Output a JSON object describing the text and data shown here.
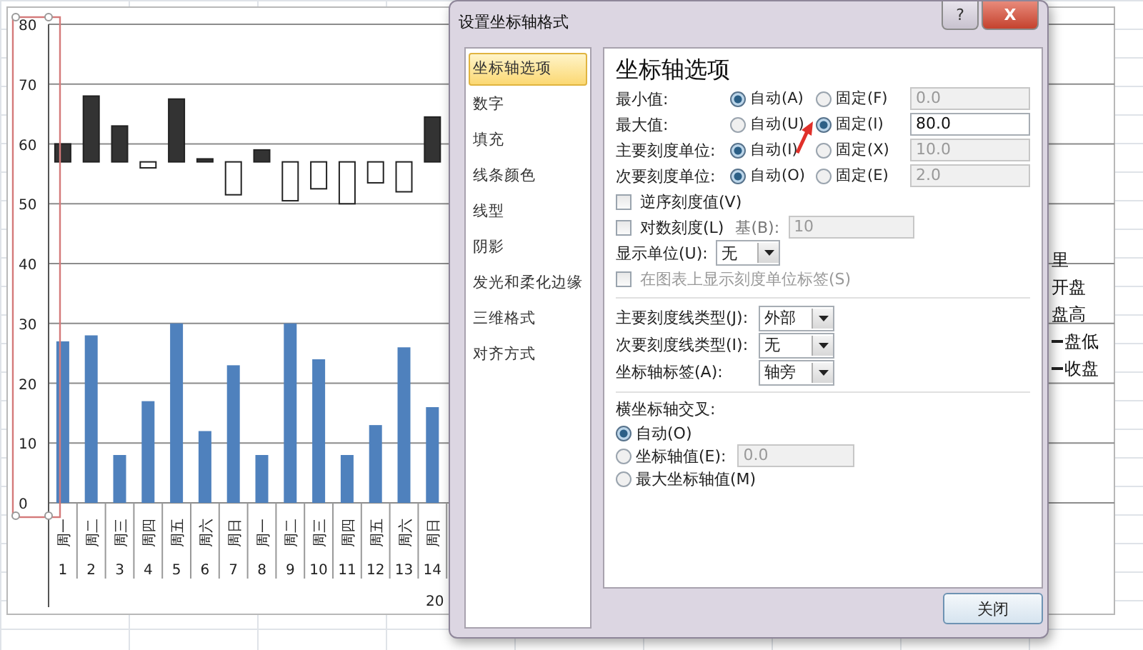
{
  "chart": {
    "chart_data": {
      "type": "bar",
      "categories": [
        "周一",
        "周二",
        "周三",
        "周四",
        "周五",
        "周六",
        "周日",
        "周一",
        "周二",
        "周三",
        "周四",
        "周五",
        "周六",
        "周日"
      ],
      "xlabel": "20",
      "ylim": [
        0,
        80
      ],
      "yticks": [
        0,
        10,
        20,
        30,
        40,
        50,
        60,
        70,
        80
      ],
      "grid": true,
      "series": [
        {
          "color": "#4f81bd",
          "values": [
            27,
            28,
            8,
            17,
            30,
            12,
            23,
            8,
            30,
            24,
            8,
            13,
            26,
            16
          ]
        }
      ]
    },
    "category_numbers": [
      "1",
      "2",
      "3",
      "4",
      "5",
      "6",
      "7",
      "8",
      "9",
      "10",
      "11",
      "12",
      "13",
      "14"
    ],
    "legend": [
      {
        "label": "里",
        "line": false
      },
      {
        "label": "开盘",
        "line": false
      },
      {
        "label": "盘高",
        "line": false
      },
      {
        "label": "盘低",
        "line": true
      },
      {
        "label": "收盘",
        "line": true
      }
    ]
  },
  "dialog": {
    "title": "设置坐标轴格式",
    "help": "?",
    "close": "X",
    "nav": [
      {
        "label": "坐标轴选项",
        "selected": true
      },
      {
        "label": "数字",
        "selected": false
      },
      {
        "label": "填充",
        "selected": false
      },
      {
        "label": "线条颜色",
        "selected": false
      },
      {
        "label": "线型",
        "selected": false
      },
      {
        "label": "阴影",
        "selected": false
      },
      {
        "label": "发光和柔化边缘",
        "selected": false
      },
      {
        "label": "三维格式",
        "selected": false
      },
      {
        "label": "对齐方式",
        "selected": false
      }
    ],
    "heading": "坐标轴选项",
    "axis_rows": [
      {
        "label": "最小值:",
        "options": [
          {
            "label": "自动(A)",
            "selected": true
          },
          {
            "label": "固定(F)",
            "selected": false
          }
        ],
        "value": "0.0",
        "disabled": true
      },
      {
        "label": "最大值:",
        "options": [
          {
            "label": "自动(U)",
            "selected": false
          },
          {
            "label": "固定(I)",
            "selected": true
          }
        ],
        "value": "80.0",
        "disabled": false
      },
      {
        "label": "主要刻度单位:",
        "options": [
          {
            "label": "自动(I)",
            "selected": true
          },
          {
            "label": "固定(X)",
            "selected": false
          }
        ],
        "value": "10.0",
        "disabled": true
      },
      {
        "label": "次要刻度单位:",
        "options": [
          {
            "label": "自动(O)",
            "selected": true
          },
          {
            "label": "固定(E)",
            "selected": false
          }
        ],
        "value": "2.0",
        "disabled": true
      }
    ],
    "reverse": {
      "label": "逆序刻度值(V)",
      "checked": false
    },
    "log": {
      "label": "对数刻度(L)",
      "checked": false,
      "base_label": "基(B):",
      "base_value": "10",
      "base_disabled": true
    },
    "display_unit": {
      "label": "显示单位(U):",
      "value": "无"
    },
    "unit_label": {
      "label": "在图表上显示刻度单位标签(S)",
      "checked": false,
      "disabled": true
    },
    "tick_rows": [
      {
        "label": "主要刻度线类型(J):",
        "value": "外部"
      },
      {
        "label": "次要刻度线类型(I):",
        "value": "无"
      },
      {
        "label": "坐标轴标签(A):",
        "value": "轴旁"
      }
    ],
    "crossing": {
      "title": "横坐标轴交叉:",
      "options": [
        {
          "label": "自动(O)",
          "selected": true
        },
        {
          "label": "坐标轴值(E):",
          "selected": false,
          "value": "0.0",
          "disabled": true
        },
        {
          "label": "最大坐标轴值(M)",
          "selected": false
        }
      ]
    },
    "close_button": "关闭"
  }
}
